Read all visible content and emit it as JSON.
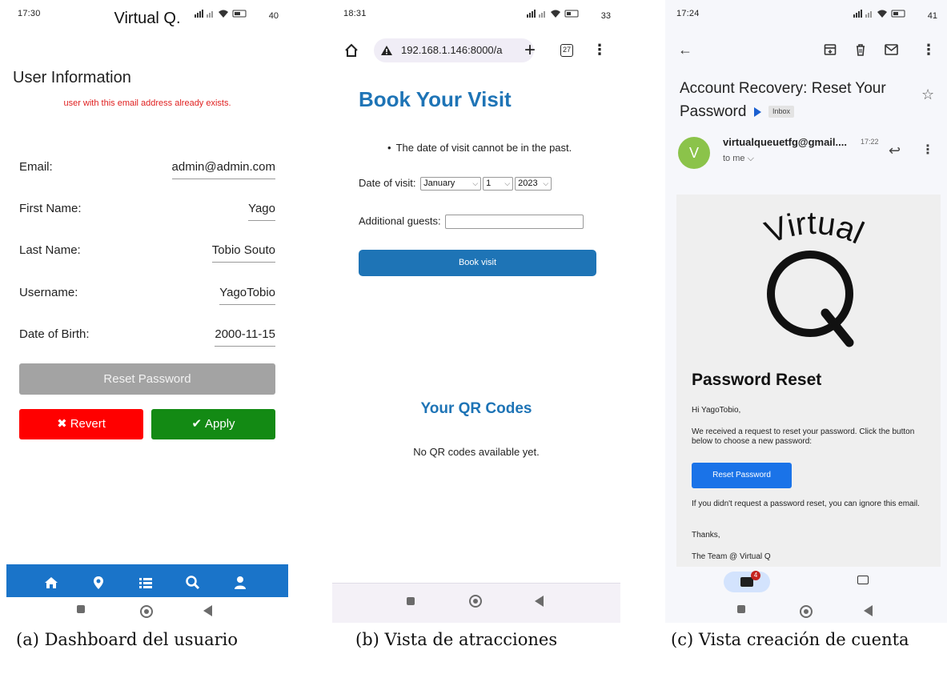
{
  "panel_a": {
    "status_time": "17:30",
    "status_right": "40",
    "app_title": "Virtual Q.",
    "section_title": "User Information",
    "error_message": "user with this email address already exists.",
    "fields": [
      {
        "label": "Email:",
        "value": "admin@admin.com"
      },
      {
        "label": "First Name:",
        "value": "Yago"
      },
      {
        "label": "Last Name:",
        "value": "Tobio Souto"
      },
      {
        "label": "Username:",
        "value": "YagoTobio"
      },
      {
        "label": "Date of Birth:",
        "value": "2000-11-15"
      }
    ],
    "reset_password_label": "Reset Password",
    "revert_label": "Revert",
    "apply_label": "Apply",
    "bottom_nav_icons": [
      "home-icon",
      "location-pin-icon",
      "list-icon",
      "search-icon",
      "user-icon"
    ],
    "accent_color": "#1a74c9"
  },
  "panel_b": {
    "status_time": "18:31",
    "status_right": "33",
    "url": "192.168.1.146:8000/a",
    "tab_count": "27",
    "page_title": "Book Your Visit",
    "error_bullet": "The date of visit cannot be in the past.",
    "date_label": "Date of visit:",
    "month_value": "January",
    "day_value": "1",
    "year_value": "2023",
    "guests_label": "Additional guests:",
    "book_button_label": "Book visit",
    "qr_title": "Your QR Codes",
    "qr_empty": "No QR codes available yet.",
    "accent_color": "#1e74b6"
  },
  "panel_c": {
    "status_time": "17:24",
    "status_right": "41",
    "subject_line1": "Account Recovery: Reset Your",
    "subject_line2": "Password",
    "label_chip": "Inbox",
    "avatar_letter": "V",
    "sender": "virtualqueuetfg@gmail....",
    "sender_time": "17:22",
    "to_me": "to me",
    "logo_text": "Virtual",
    "logo_letter": "Q",
    "heading": "Password Reset",
    "greeting": "Hi YagoTobio,",
    "body1": "We received a request to reset your password. Click the button below to choose a new password:",
    "button_label": "Reset Password",
    "body2": "If you didn't request a password reset, you can ignore this email.",
    "thanks": "Thanks,",
    "signature": "The Team @ Virtual Q",
    "mail_badge": "4",
    "accent_color": "#1a73e8"
  },
  "captions": {
    "a": "(a) Dashboard del usuario",
    "b": "(b) Vista de atracciones",
    "c": "(c) Vista creación de cuenta"
  }
}
